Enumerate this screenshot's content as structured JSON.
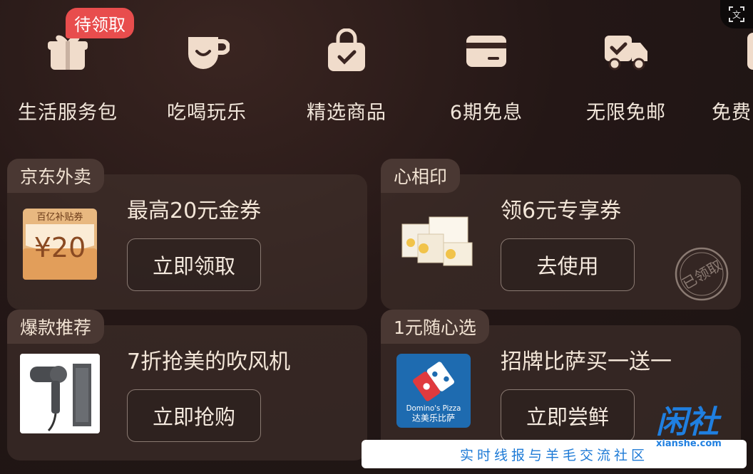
{
  "services": [
    {
      "label": "生活服务包",
      "icon": "gift-box-icon"
    },
    {
      "label": "吃喝玩乐",
      "icon": "coffee-cup-icon"
    },
    {
      "label": "精选商品",
      "icon": "shopping-bag-icon"
    },
    {
      "label": "6期免息",
      "icon": "credit-card-icon"
    },
    {
      "label": "无限免邮",
      "icon": "delivery-truck-icon"
    },
    {
      "label": "免费",
      "icon": "partial-icon"
    }
  ],
  "pending_badge": "待领取",
  "cards": [
    {
      "tag": "京东外卖",
      "title": "最高20元金券",
      "button": "立即领取",
      "thumb_icon": "coupon-envelope-icon",
      "thumb_text_top": "百亿补贴券",
      "thumb_text_value": "¥20"
    },
    {
      "tag": "心相印",
      "title": "领6元专享券",
      "button": "去使用",
      "thumb_icon": "tissue-pack-icon",
      "stamp": "已领取"
    },
    {
      "tag": "爆款推荐",
      "title": "7折抢美的吹风机",
      "button": "立即抢购",
      "thumb_icon": "hair-dryer-icon"
    },
    {
      "tag": "1元随心选",
      "title": "招牌比萨买一送一",
      "button": "立即尝鲜",
      "thumb_icon": "dominos-logo-icon",
      "thumb_text_top": "Domino's Pizza",
      "thumb_text_value": "达美乐比萨"
    }
  ],
  "watermark": {
    "slogan": "实时线报与羊毛交流社区",
    "logo_text": "闲社",
    "url": "xianshe.com"
  },
  "colors": {
    "accent": "#e84d4d",
    "icon_fill": "#f0dccb",
    "brand_blue": "#1f7fe0"
  }
}
